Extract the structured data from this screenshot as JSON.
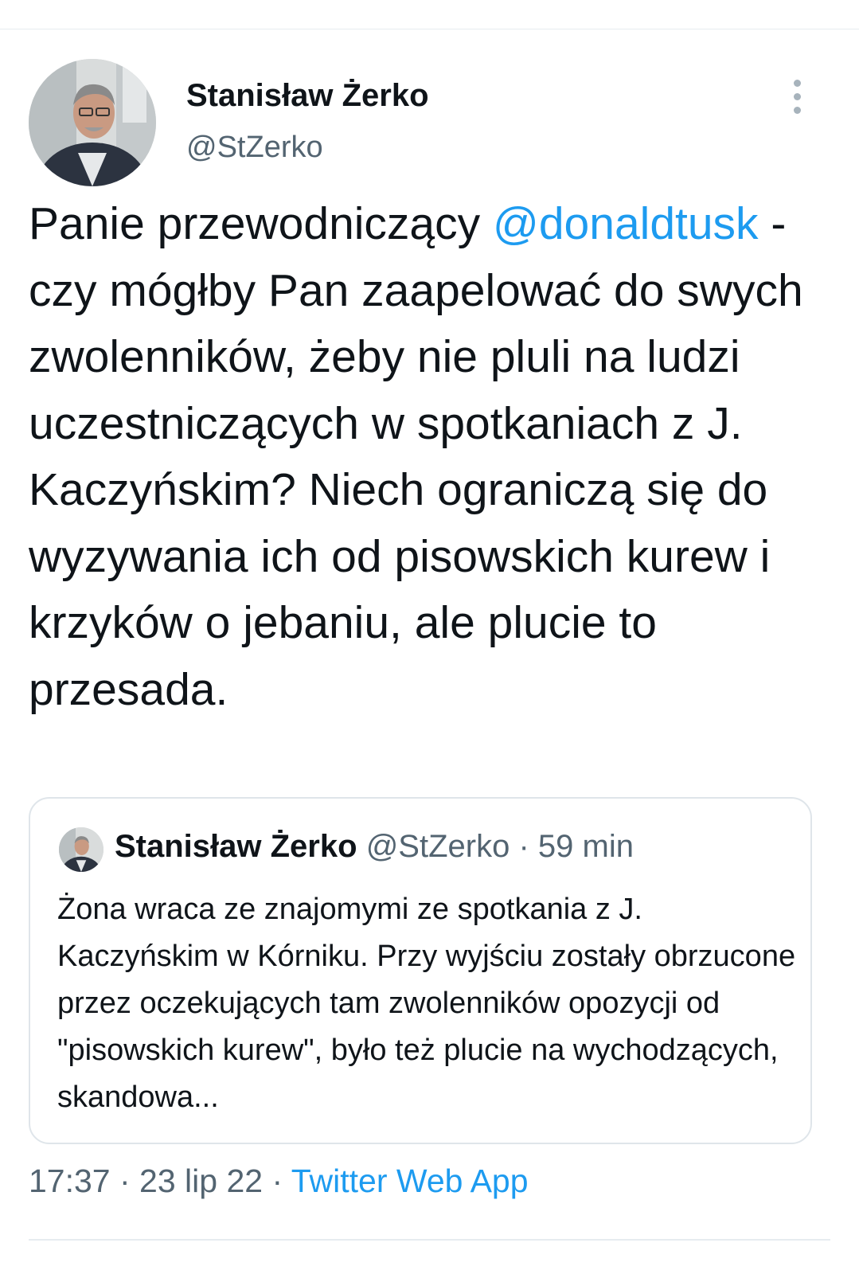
{
  "tweet": {
    "author_name": "Stanisław Żerko",
    "author_handle": "@StZerko",
    "text_before_mention": "Panie przewodniczący ",
    "mention": "@donaldtusk",
    "text_after_mention": " - czy mógłby Pan zaapelować do swych zwolenników, żeby nie pluli na ludzi uczestniczących w spotkaniach z J. Kaczyńskim? Niech ograniczą się do wyzywania ich od pisowskich kurew i krzyków o jebaniu, ale plucie to przesada.",
    "time": "17:37",
    "separator": " · ",
    "date": "23 lip 22",
    "source": "Twitter Web App"
  },
  "quoted_tweet": {
    "author_name": "Stanisław Żerko",
    "author_handle": "@StZerko",
    "separator": " · ",
    "time_ago": "59 min",
    "text": "Żona wraca ze znajomymi ze spotkania z J. Kaczyńskim w Kórniku. Przy wyjściu zostały obrzucone przez oczekujących tam zwolenników opozycji od \"pisowskich kurew\", było też plucie na wychodzących,  skandowa..."
  },
  "icons": {
    "more": "more-vertical-icon"
  },
  "colors": {
    "link": "#1d9bf0",
    "secondary_text": "#536471",
    "primary_text": "#0f1419",
    "border": "#dfe5ea"
  }
}
